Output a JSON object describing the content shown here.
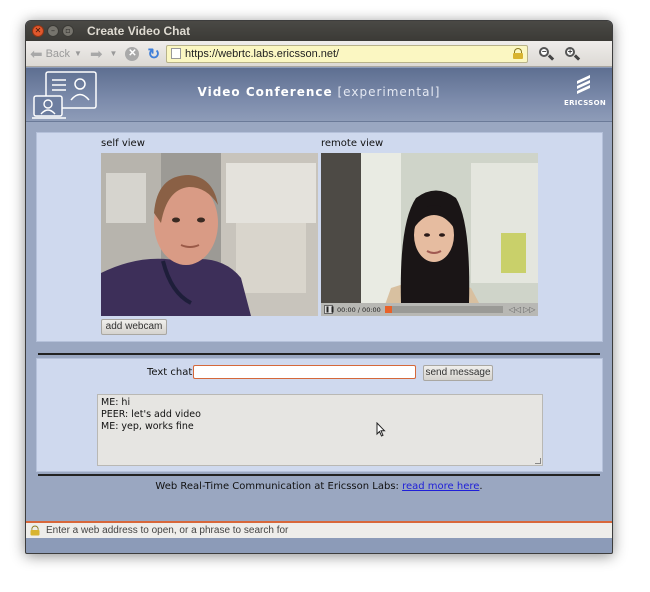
{
  "window": {
    "title": "Create Video Chat"
  },
  "toolbar": {
    "back_label": "Back",
    "url": "https://webrtc.labs.ericsson.net/"
  },
  "header": {
    "title_bold": "Video Conference",
    "title_suffix": "[experimental]",
    "brand": "ERICSSON"
  },
  "video": {
    "self_label": "self view",
    "remote_label": "remote view",
    "time": "00:00 / 00:00",
    "add_webcam": "add webcam"
  },
  "chat": {
    "label": "Text chat",
    "input_value": "",
    "send_label": "send message",
    "log": [
      "ME: hi",
      "PEER: let's add video",
      "ME: yep, works fine"
    ]
  },
  "footer": {
    "text": "Web Real-Time Communication at Ericsson Labs: ",
    "link": "read more here",
    "after": "."
  },
  "status": {
    "text": "Enter a web address to open, or a phrase to search for"
  },
  "colors": {
    "accent": "#e8622a",
    "page_bg": "#9aa7c1",
    "panel_bg": "#cfd9ee"
  }
}
